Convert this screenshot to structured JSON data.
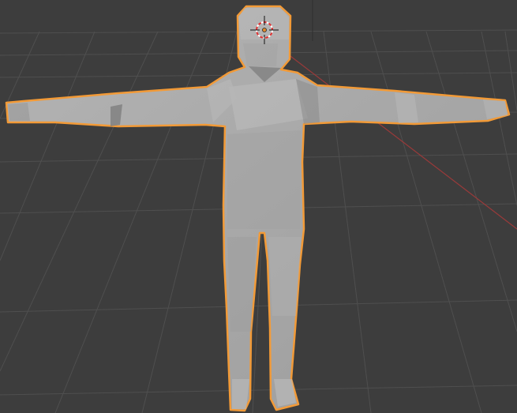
{
  "viewport": {
    "background_color": "#3d3d3d",
    "grid_color": "#4f4f4f",
    "x_axis_color": "#9a3a3a",
    "selection_outline_color": "#f29a37",
    "mesh_fill_color": "#a9a9a9"
  },
  "scene": {
    "selected_object": "humanoid-mesh",
    "cursor_icon": "3d-cursor-icon"
  }
}
